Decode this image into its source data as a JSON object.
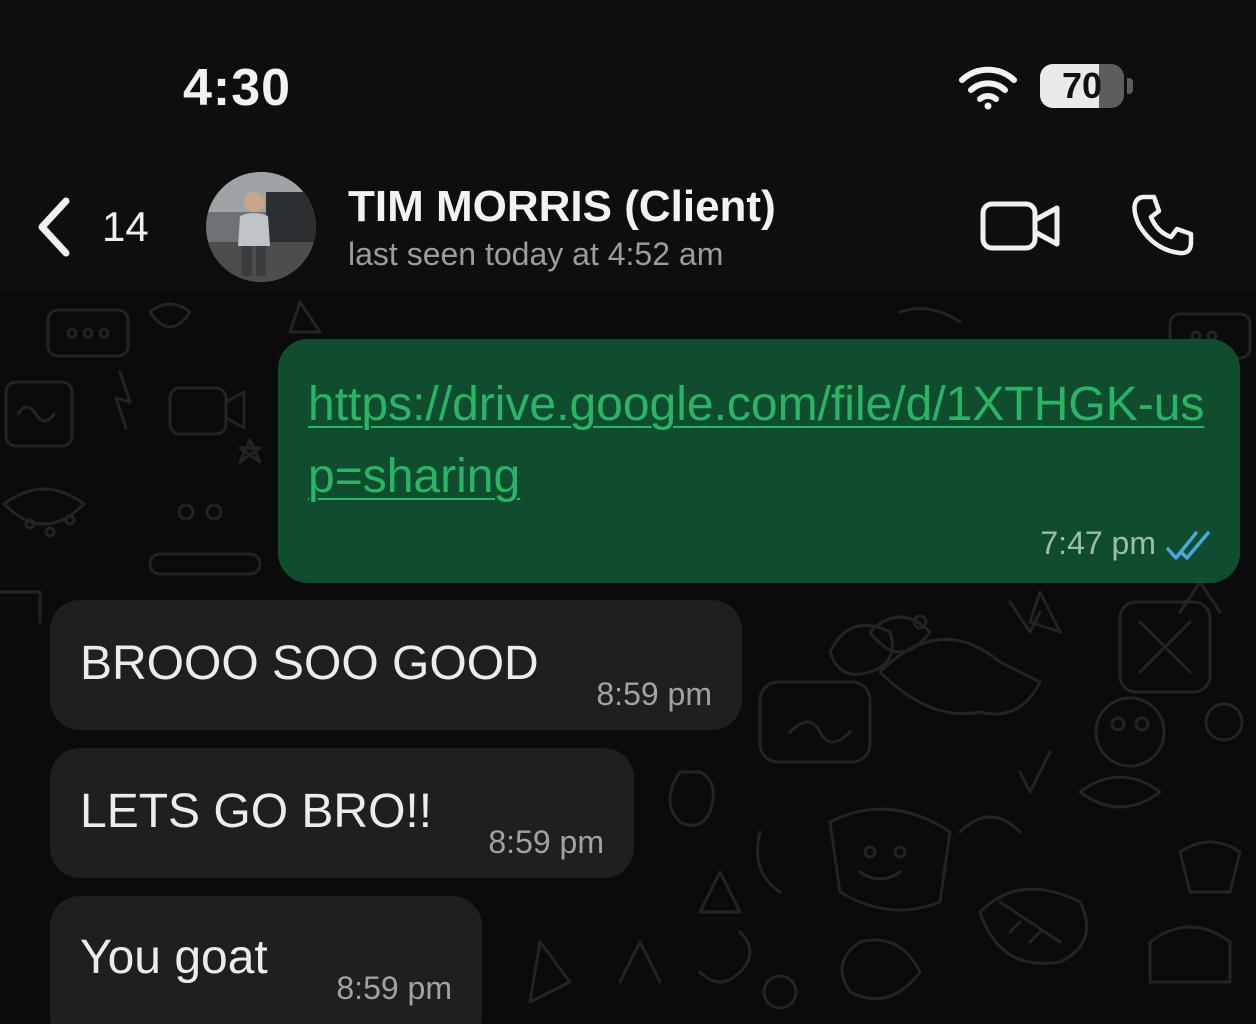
{
  "status_bar": {
    "time": "4:30",
    "battery_level": "70",
    "battery_fraction": 0.7,
    "icons": [
      "wifi-icon",
      "battery-icon"
    ]
  },
  "header": {
    "back_count": "14",
    "contact_name": "TIM MORRIS (Client)",
    "last_seen": "last seen today at 4:52 am",
    "icons": [
      "chevron-left-icon",
      "video-call-icon",
      "phone-icon"
    ]
  },
  "messages": [
    {
      "direction": "outgoing",
      "text": "https://drive.google.com/file/d/1XTHGK-usp=sharing",
      "time": "7:47 pm",
      "status": "read"
    },
    {
      "direction": "incoming",
      "text": "BROOO SOO GOOD",
      "time": "8:59 pm"
    },
    {
      "direction": "incoming",
      "text": "LETS GO BRO!!",
      "time": "8:59 pm"
    },
    {
      "direction": "incoming",
      "text": "You goat",
      "time": "8:59 pm"
    }
  ],
  "colors": {
    "outgoing_bubble": "#0f4d2e",
    "incoming_bubble": "#1f1f1f",
    "link": "#29b565",
    "read_ticks": "#4aa8e0"
  }
}
